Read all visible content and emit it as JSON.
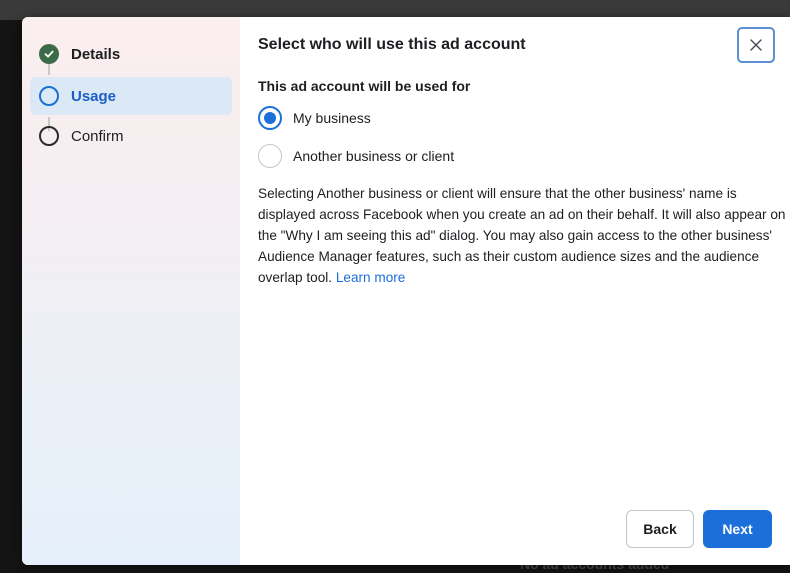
{
  "background": {
    "bottom_text": "No ad accounts added"
  },
  "sidebar": {
    "steps": [
      {
        "label": "Details",
        "state": "completed",
        "icon": "check-circle-icon"
      },
      {
        "label": "Usage",
        "state": "current",
        "icon": "circle-outline-icon"
      },
      {
        "label": "Confirm",
        "state": "upcoming",
        "icon": "circle-outline-icon"
      }
    ]
  },
  "dialog": {
    "title": "Select who will use this ad account",
    "close_icon": "close-icon",
    "section_label": "This ad account will be used for",
    "options": [
      {
        "label": "My business",
        "selected": true
      },
      {
        "label": "Another business or client",
        "selected": false
      }
    ],
    "description": "Selecting Another business or client will ensure that the other business' name is displayed across Facebook when you create an ad on their behalf. It will also appear on the \"Why I am seeing this ad\" dialog. You may also gain access to the other business' Audience Manager features, such as their custom audience sizes and the audience overlap tool.",
    "learn_more": "Learn more",
    "back_label": "Back",
    "next_label": "Next"
  },
  "colors": {
    "accent": "#1b6fd8",
    "completed": "#3d6b49",
    "active_step_bg": "#dbe8f6"
  }
}
